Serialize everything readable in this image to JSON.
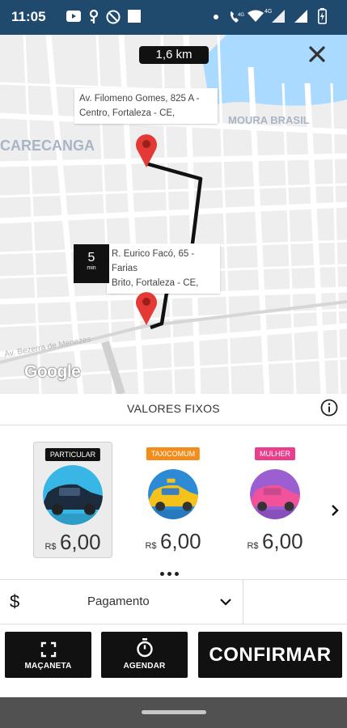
{
  "status_bar": {
    "time": "11:05",
    "left_icons": [
      "youtube-icon",
      "key-icon",
      "no-image-icon",
      "square-icon"
    ],
    "right_icons": [
      "dot-icon",
      "wifi-call-icon",
      "wifi-icon",
      "4g-signal-icon",
      "signal-icon",
      "battery-icon"
    ],
    "network": "4G"
  },
  "map": {
    "distance": "1,6 km",
    "neighborhoods": [
      "CARECANGA",
      "MOURA BRASIL"
    ],
    "streets": [
      "Av. Bezerra de Menezes"
    ],
    "origin_address": [
      "Av. Filomeno Gomes, 825 A -",
      "Centro, Fortaleza - CE,"
    ],
    "destination_address": [
      "R. Eurico Facó, 65 - Farias",
      "Brito, Fortaleza - CE,"
    ],
    "eta_value": "5",
    "eta_unit": "min",
    "attribution": "Google",
    "route_color": "#111111",
    "pin_color": "#e53935"
  },
  "fixed_bar": {
    "title": "VALORES FIXOS"
  },
  "categories": [
    {
      "badge": "PARTICULAR",
      "badge_color": "#111111",
      "currency": "R$",
      "price": "6,00",
      "selected": true,
      "car_color": "#1c2b3d",
      "bg_color": "#38b7e6"
    },
    {
      "badge": "TAXICOMUM",
      "badge_color": "#f28c1a",
      "currency": "R$",
      "price": "6,00",
      "selected": false,
      "car_color": "#f5c21b",
      "bg_color": "#2d8bd6"
    },
    {
      "badge": "MULHER",
      "badge_color": "#e83e8c",
      "currency": "R$",
      "price": "6,00",
      "selected": false,
      "car_color": "#f0529b",
      "bg_color": "#9b5fd1"
    }
  ],
  "payment": {
    "icon": "$",
    "label": "Pagamento"
  },
  "buttons": {
    "macaneta": "MAÇANETA",
    "agendar": "AGENDAR",
    "confirmar": "CONFIRMAR"
  }
}
